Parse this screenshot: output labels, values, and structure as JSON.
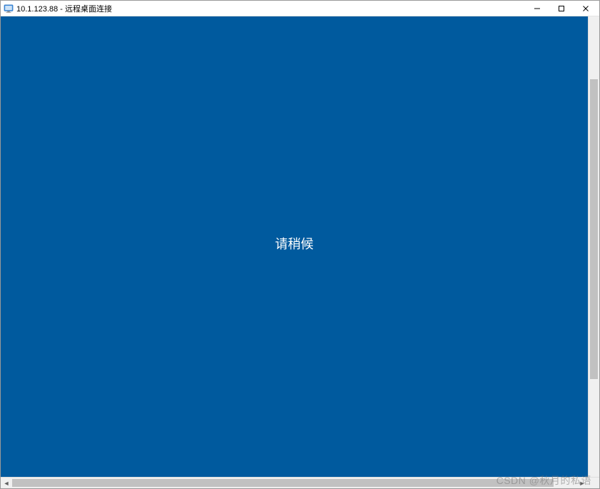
{
  "titlebar": {
    "title": "10.1.123.88 - 远程桌面连接"
  },
  "window_controls": {
    "minimize": "minimize",
    "maximize": "maximize",
    "close": "close"
  },
  "remote": {
    "wait_message": "请稍候"
  },
  "watermark": "CSDN @秋月的私语",
  "colors": {
    "remote_bg": "#005a9e",
    "titlebar_bg": "#ffffff",
    "text_on_blue": "#ffffff"
  }
}
